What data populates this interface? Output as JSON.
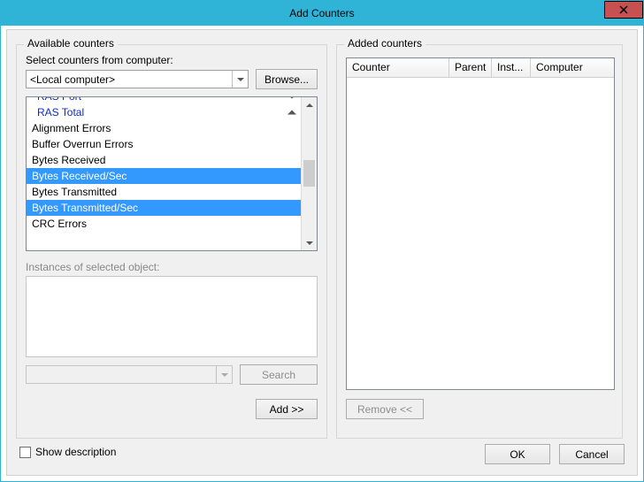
{
  "window": {
    "title": "Add Counters"
  },
  "available": {
    "group_label": "Available counters",
    "select_label": "Select counters from computer:",
    "computer_value": "<Local computer>",
    "browse_label": "Browse...",
    "instances_label": "Instances of selected object:",
    "search_label": "Search",
    "add_label": "Add >>"
  },
  "counter_tree": {
    "headers": [
      {
        "label": "RAS Port",
        "expanded": false,
        "clipped": true
      },
      {
        "label": "RAS Total",
        "expanded": true
      }
    ],
    "children": [
      {
        "label": "Alignment Errors",
        "selected": false
      },
      {
        "label": "Buffer Overrun Errors",
        "selected": false
      },
      {
        "label": "Bytes Received",
        "selected": false
      },
      {
        "label": "Bytes Received/Sec",
        "selected": true
      },
      {
        "label": "Bytes Transmitted",
        "selected": false
      },
      {
        "label": "Bytes Transmitted/Sec",
        "selected": true
      },
      {
        "label": "CRC Errors",
        "selected": false
      }
    ]
  },
  "added": {
    "group_label": "Added counters",
    "columns": {
      "counter": "Counter",
      "parent": "Parent",
      "inst": "Inst...",
      "computer": "Computer"
    },
    "remove_label": "Remove <<"
  },
  "footer": {
    "show_desc_label": "Show description",
    "ok_label": "OK",
    "cancel_label": "Cancel"
  }
}
